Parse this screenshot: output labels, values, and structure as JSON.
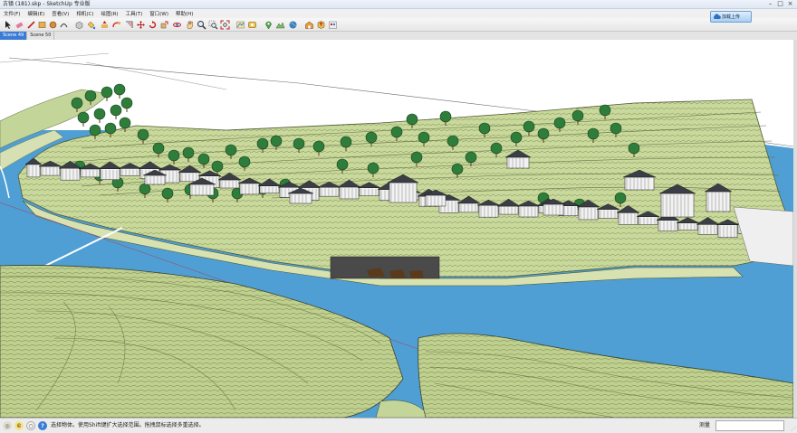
{
  "window": {
    "title": "古镇 (181).skp - SketchUp 专业版"
  },
  "menus": [
    "文件(F)",
    "编辑(E)",
    "查看(V)",
    "相机(C)",
    "绘图(R)",
    "工具(T)",
    "窗口(W)",
    "帮助(H)"
  ],
  "toolbar": {
    "account_label": "加载上传"
  },
  "scene_tabs": [
    {
      "label": "Scene 49",
      "active": true
    },
    {
      "label": "Scene 50",
      "active": false
    }
  ],
  "status": {
    "message": "选择物体。使用Shift键扩大选择范围。拖拽鼠标选择多重选择。",
    "measure_label": "测量",
    "measure_value": ""
  },
  "colors": {
    "water": "#4d9fd6",
    "terrain": "#c8d99a",
    "accent": "#3a7bd5"
  }
}
